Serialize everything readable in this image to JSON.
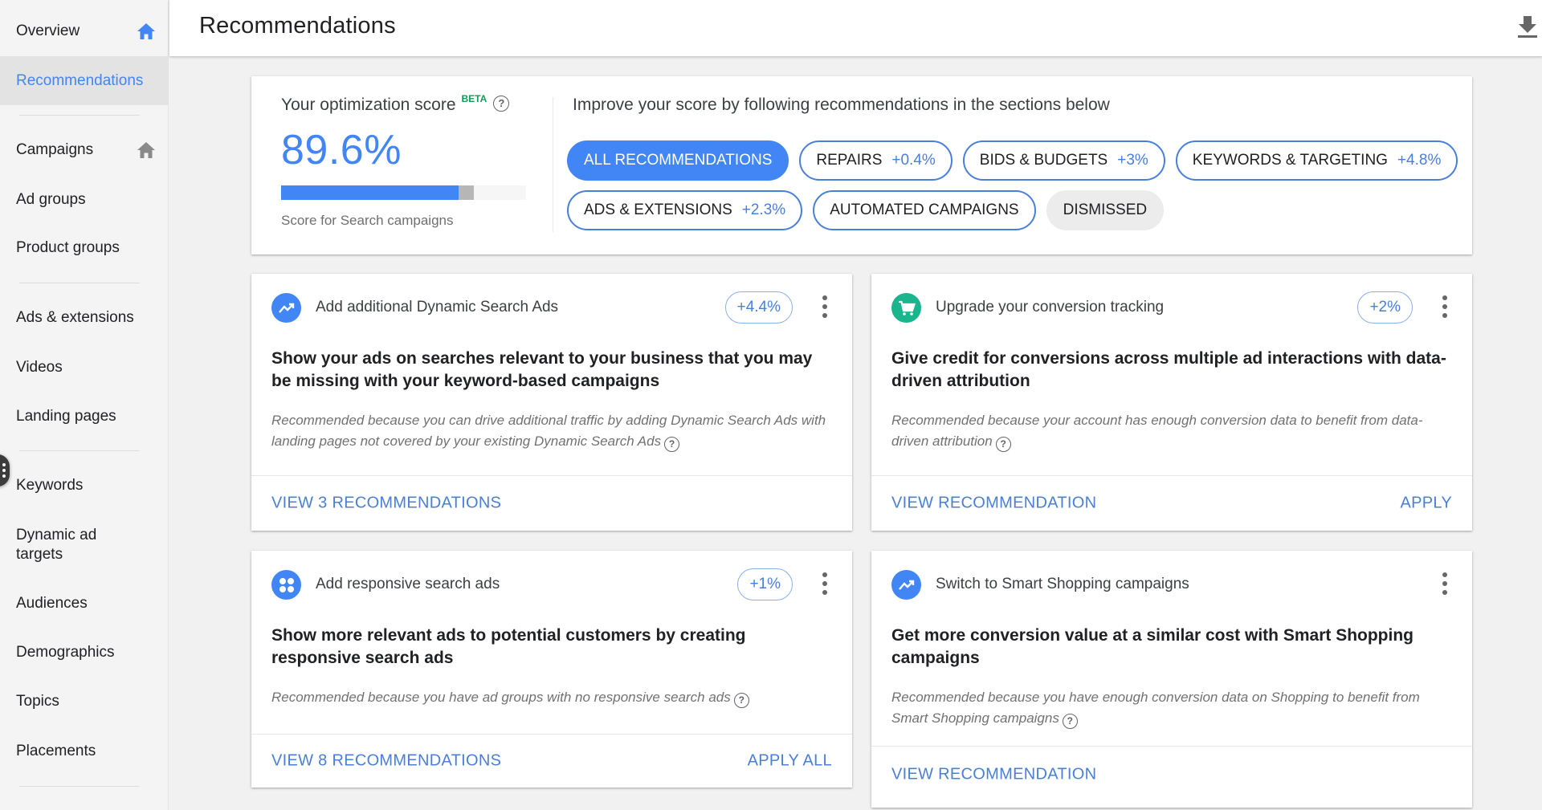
{
  "sidebar": {
    "items": [
      {
        "label": "Overview",
        "icon": "home-icon",
        "icon_color": "#4285f4"
      },
      {
        "label": "Recommendations",
        "active": true
      },
      {
        "label": "Campaigns",
        "icon": "home-icon",
        "icon_color": "#8a8a8a"
      },
      {
        "label": "Ad groups"
      },
      {
        "label": "Product groups"
      },
      {
        "label": "Ads & extensions"
      },
      {
        "label": "Videos"
      },
      {
        "label": "Landing pages"
      },
      {
        "label": "Keywords"
      },
      {
        "label": "Dynamic ad targets"
      },
      {
        "label": "Audiences"
      },
      {
        "label": "Demographics"
      },
      {
        "label": "Topics"
      },
      {
        "label": "Placements"
      }
    ]
  },
  "header": {
    "title": "Recommendations",
    "download_icon": "download-icon"
  },
  "score": {
    "label": "Your optimization score",
    "badge": "BETA",
    "value": "89.6%",
    "progress_percent": 89.6,
    "potential_percent": 6,
    "subtitle": "Score for Search campaigns",
    "improve_text": "Improve your score by following recommendations in the sections below"
  },
  "filters": [
    {
      "label": "ALL RECOMMENDATIONS",
      "uplift": "",
      "state": "selected"
    },
    {
      "label": "REPAIRS",
      "uplift": "+0.4%",
      "state": "outlined"
    },
    {
      "label": "BIDS & BUDGETS",
      "uplift": "+3%",
      "state": "outlined"
    },
    {
      "label": "KEYWORDS & TARGETING",
      "uplift": "+4.8%",
      "state": "outlined"
    },
    {
      "label": "ADS & EXTENSIONS",
      "uplift": "+2.3%",
      "state": "outlined"
    },
    {
      "label": "AUTOMATED CAMPAIGNS",
      "uplift": "",
      "state": "outlined"
    },
    {
      "label": "DISMISSED",
      "uplift": "",
      "state": "muted"
    }
  ],
  "cards": [
    {
      "icon": "trending-up-icon",
      "icon_color": "#4285f4",
      "title": "Add additional Dynamic Search Ads",
      "uplift": "+4.4%",
      "headline": "Show your ads on searches relevant to your business that you may be missing with your keyword-based campaigns",
      "reason": "Recommended because you can drive additional traffic by adding Dynamic Search Ads with landing pages not covered by your existing Dynamic Search Ads",
      "primary_action": "VIEW 3 RECOMMENDATIONS",
      "secondary_action": ""
    },
    {
      "icon": "shopping-cart-icon",
      "icon_color": "#1bb58d",
      "title": "Upgrade your conversion tracking",
      "uplift": "+2%",
      "headline": "Give credit for conversions across multiple ad interactions with data-driven attribution",
      "reason": "Recommended because your account has enough conversion data to benefit from data-driven attribution",
      "primary_action": "VIEW RECOMMENDATION",
      "secondary_action": "APPLY"
    },
    {
      "icon": "apps-grid-icon",
      "icon_color": "#4285f4",
      "title": "Add responsive search ads",
      "uplift": "+1%",
      "headline": "Show more relevant ads to potential customers by creating responsive search ads",
      "reason": "Recommended because you have ad groups with no responsive search ads",
      "primary_action": "VIEW 8 RECOMMENDATIONS",
      "secondary_action": "APPLY ALL"
    },
    {
      "icon": "trending-up-icon",
      "icon_color": "#4285f4",
      "title": "Switch to Smart Shopping campaigns",
      "uplift": "",
      "headline": "Get more conversion value at a similar cost with Smart Shopping campaigns",
      "reason": "Recommended because you have enough conversion data on Shopping to benefit from Smart Shopping campaigns",
      "primary_action": "VIEW RECOMMENDATION",
      "secondary_action": ""
    }
  ],
  "help_glyph": "?",
  "colors": {
    "accent": "#4285f4",
    "link": "#4a7fd8",
    "beta": "#0f9d58",
    "cart_icon_bg": "#1bb58d"
  }
}
